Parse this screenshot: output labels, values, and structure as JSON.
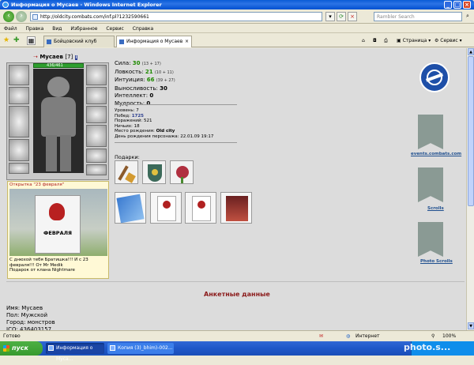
{
  "window": {
    "title": "Информация о Мусаев - Windows Internet Explorer"
  },
  "address": {
    "url": "http://oldcity.combats.com/inf.pl?1232590661"
  },
  "search": {
    "placeholder": "Rambler Search"
  },
  "menu": [
    "Файл",
    "Правка",
    "Вид",
    "Избранное",
    "Сервис",
    "Справка"
  ],
  "tabs": [
    {
      "label": "Бойцовский клуб",
      "active": false
    },
    {
      "label": "Информация о Мусаев",
      "active": true
    }
  ],
  "toolbar_right": {
    "page_label": "Страница",
    "tools_label": "Сервис"
  },
  "character": {
    "name": "Мусаев",
    "level": "[7]",
    "badge": "i",
    "hp": "436/461"
  },
  "stats": [
    {
      "label": "Сила:",
      "value": "30",
      "extra": "(13 + 17)"
    },
    {
      "label": "Ловкость:",
      "value": "21",
      "extra": "(10 + 11)"
    },
    {
      "label": "Интуиция:",
      "value": "66",
      "extra": "(39 + 27)"
    },
    {
      "label": "Выносливость:",
      "value": "30",
      "extra": ""
    },
    {
      "label": "Интеллект:",
      "value": "0",
      "extra": ""
    },
    {
      "label": "Мудрость:",
      "value": "0",
      "extra": ""
    }
  ],
  "info": {
    "level": "Уровень: 7",
    "wins_label": "Побед:",
    "wins": "1725",
    "losses": "Поражений: 521",
    "draws": "Ничьих: 18",
    "birthplace_label": "Место рождения:",
    "birthplace": "Old city",
    "birthday": "День рождения персонажа: 22.01.09 19:17"
  },
  "gifts_label": "Подарки:",
  "card": {
    "title": "Открытка \"23 февраля\"",
    "image_text": "ФЕВРАЛЯ",
    "message_1": "С днюхой тебя Братишка!!! И с 23",
    "message_2": "февраля!!! От Mr Medik",
    "message_3": "Подарок от клана Nightmare"
  },
  "right_links": [
    {
      "label": "events.combats.com"
    },
    {
      "label": "Scrolls"
    },
    {
      "label": "Photo Scrolls"
    }
  ],
  "anketa_title": "Анкетные данные",
  "profile": {
    "name": "Имя: Мусаев",
    "gender": "Пол: Мужской",
    "city": "Город: монстров",
    "icq": "ICQ: 436403157"
  },
  "status": {
    "left": "Готово",
    "zone": "Интернет",
    "zoom": "100%"
  },
  "taskbar": {
    "start": "пуск",
    "tasks": [
      {
        "label": "Информация о Муса..."
      },
      {
        "label": "Копия (3)_bhim)-002..."
      }
    ],
    "watermark": "photo.s..."
  },
  "colors": {
    "accent_green": "#1F8A00",
    "link_navy": "#2A3D8F",
    "anketa_red": "#8B1A1A",
    "content_bg": "#DCDCDC"
  }
}
